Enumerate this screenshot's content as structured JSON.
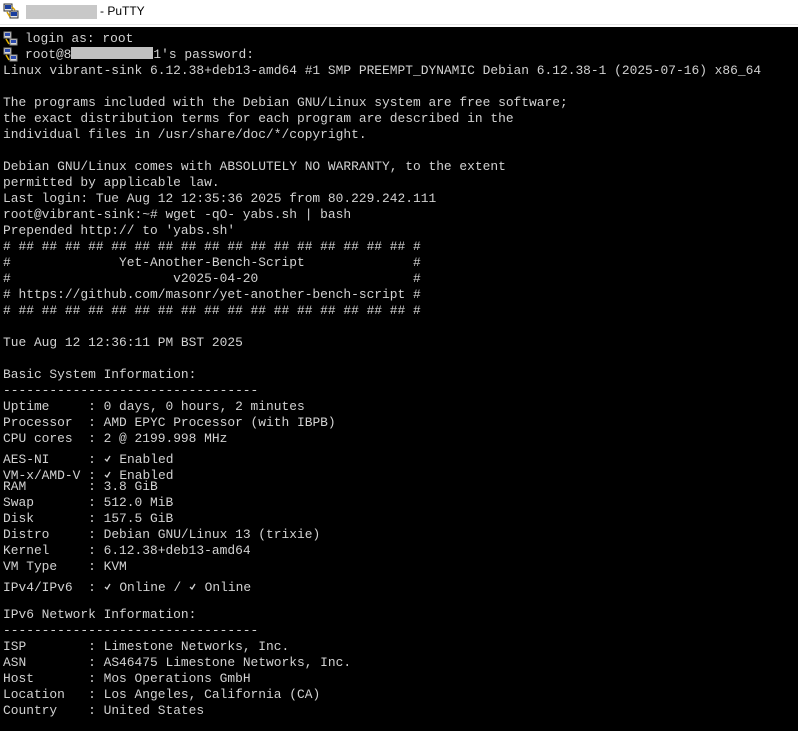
{
  "window": {
    "title": "- PuTTY",
    "title_redacted": true
  },
  "terminal": {
    "login_line": "login as: root",
    "password_prefix": "root@8",
    "password_suffix": "1's password:",
    "kernel_banner": "Linux vibrant-sink 6.12.38+deb13-amd64 #1 SMP PREEMPT_DYNAMIC Debian 6.12.38-1 (2025-07-16) x86_64",
    "motd_1": "The programs included with the Debian GNU/Linux system are free software;",
    "motd_2": "the exact distribution terms for each program are described in the",
    "motd_3": "individual files in /usr/share/doc/*/copyright.",
    "motd_4": "Debian GNU/Linux comes with ABSOLUTELY NO WARRANTY, to the extent",
    "motd_5": "permitted by applicable law.",
    "last_login": "Last login: Tue Aug 12 12:35:36 2025 from 80.229.242.111",
    "command": "root@vibrant-sink:~# wget -qO- yabs.sh | bash",
    "prepended": "Prepended http:// to 'yabs.sh'",
    "banner_border": "# ## ## ## ## ## ## ## ## ## ## ## ## ## ## ## ## ## #",
    "banner_name": "#              Yet-Another-Bench-Script              #",
    "banner_version": "#                     v2025-04-20                    #",
    "banner_url": "# https://github.com/masonr/yet-another-bench-script #",
    "datetime": "Tue Aug 12 12:36:11 PM BST 2025",
    "section_basic": "Basic System Information:",
    "divider": "---------------------------------",
    "basic": [
      {
        "label": "Uptime     : ",
        "value": "0 days, 0 hours, 2 minutes",
        "tick": false
      },
      {
        "label": "Processor  : ",
        "value": "AMD EPYC Processor (with IBPB)",
        "tick": false
      },
      {
        "label": "CPU cores  : ",
        "value": "2 @ 2199.998 MHz",
        "tick": false
      },
      {
        "label": "AES-NI     : ",
        "value": " Enabled",
        "tick": true
      },
      {
        "label": "VM-x/AMD-V : ",
        "value": " Enabled",
        "tick": true
      },
      {
        "label": "RAM        : ",
        "value": "3.8 GiB",
        "tick": false
      },
      {
        "label": "Swap       : ",
        "value": "512.0 MiB",
        "tick": false
      },
      {
        "label": "Disk       : ",
        "value": "157.5 GiB",
        "tick": false
      },
      {
        "label": "Distro     : ",
        "value": "Debian GNU/Linux 13 (trixie)",
        "tick": false
      },
      {
        "label": "Kernel     : ",
        "value": "6.12.38+deb13-amd64",
        "tick": false
      },
      {
        "label": "VM Type    : ",
        "value": "KVM",
        "tick": false
      }
    ],
    "ip_label": "IPv4/IPv6  : ",
    "ip_v4": " Online / ",
    "ip_v6": " Online",
    "section_network": "IPv6 Network Information:",
    "network": [
      {
        "label": "ISP        : ",
        "value": "Limestone Networks, Inc."
      },
      {
        "label": "ASN        : ",
        "value": "AS46475 Limestone Networks, Inc."
      },
      {
        "label": "Host       : ",
        "value": "Mos Operations GmbH"
      },
      {
        "label": "Location   : ",
        "value": "Los Angeles, California (CA)"
      },
      {
        "label": "Country    : ",
        "value": "United States"
      }
    ]
  },
  "icons": {
    "app": "putty-icon",
    "prompt": "putty-key-icon"
  },
  "colors": {
    "terminal_bg": "#000000",
    "terminal_fg": "#d2d2d2",
    "redaction": "#c0c0c0"
  }
}
